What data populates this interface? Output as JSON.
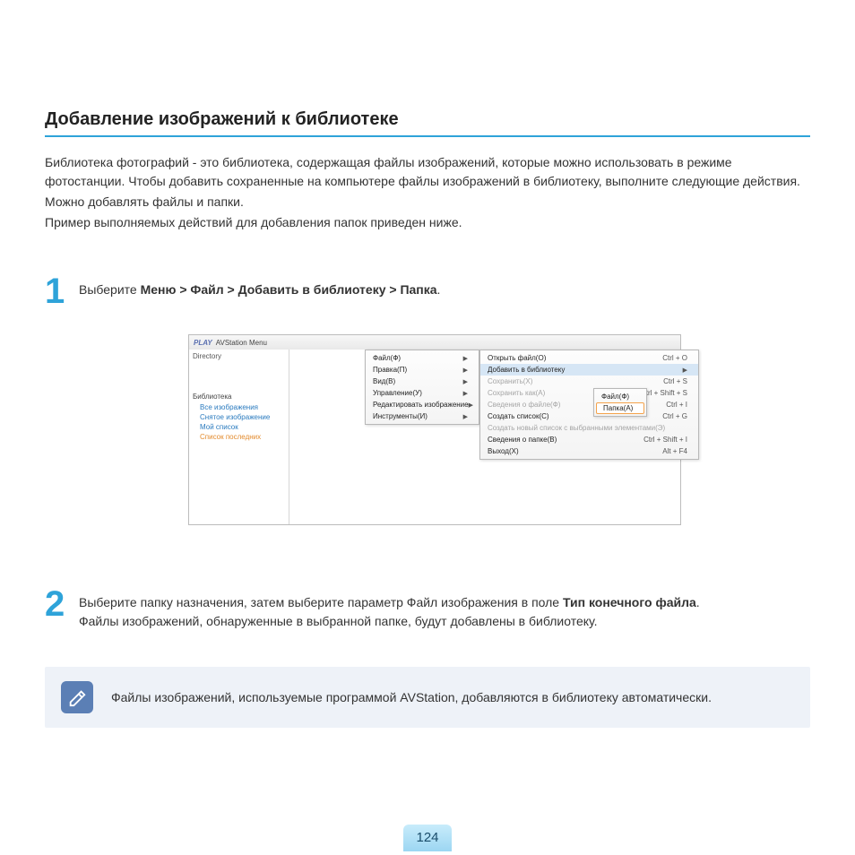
{
  "heading": "Добавление изображений к библиотеке",
  "intro": [
    "Библиотека фотографий - это библиотека, содержащая файлы изображений, которые можно использовать в режиме фотостанции. Чтобы добавить сохраненные на компьютере файлы изображений в библиотеку, выполните следующие действия.",
    "Можно добавлять файлы и папки.",
    "Пример выполняемых действий для добавления папок приведен ниже."
  ],
  "step1": {
    "num": "1",
    "pre": "Выберите ",
    "bold": "Меню > Файл > Добавить в библиотеку > Папка",
    "post": "."
  },
  "step2": {
    "num": "2",
    "line1a": "Выберите папку назначения, затем выберите параметр Файл изображения в поле ",
    "line1b": "Тип конечного файла",
    "line1c": ".",
    "line2": "Файлы изображений, обнаруженные в выбранной папке, будут добавлены в библиотеку."
  },
  "note": "Файлы изображений, используемые программой AVStation, добавляются в библиотеку автоматически.",
  "page_num": "124",
  "app": {
    "logo": "PLAY",
    "title": "AVStation  Menu",
    "sidebar": {
      "directory": "Directory",
      "library": "Библиотека",
      "items": [
        "Все изображения",
        "Снятое изображение",
        "Мой список",
        "Список последних"
      ]
    },
    "menu1": [
      "Файл(Ф)",
      "Правка(П)",
      "Вид(В)",
      "Управление(У)",
      "Редактировать изображение",
      "Инструменты(И)"
    ],
    "menu2": [
      {
        "label": "Открыть файл(О)",
        "shortcut": "Ctrl + O"
      },
      {
        "label": "Добавить в библиотеку",
        "shortcut": "",
        "hl": true,
        "arrow": true
      },
      {
        "label": "Сохранить(Х)",
        "shortcut": "Ctrl + S",
        "disabled": true
      },
      {
        "label": "Сохранить как(А)",
        "shortcut": "Ctrl + Shift + S",
        "disabled": true
      },
      {
        "label": "Сведения о файле(Ф)",
        "shortcut": "Ctrl + I",
        "disabled": true
      },
      {
        "label": "Создать список(С)",
        "shortcut": "Ctrl + G"
      },
      {
        "label": "Создать новый список с выбранными элементами(Э)",
        "shortcut": "",
        "disabled": true
      },
      {
        "label": "Сведения о папке(В)",
        "shortcut": "Ctrl + Shift + I"
      },
      {
        "label": "Выход(Х)",
        "shortcut": "Alt + F4"
      }
    ],
    "menu3": [
      "Файл(Ф)",
      "Папка(А)"
    ]
  }
}
